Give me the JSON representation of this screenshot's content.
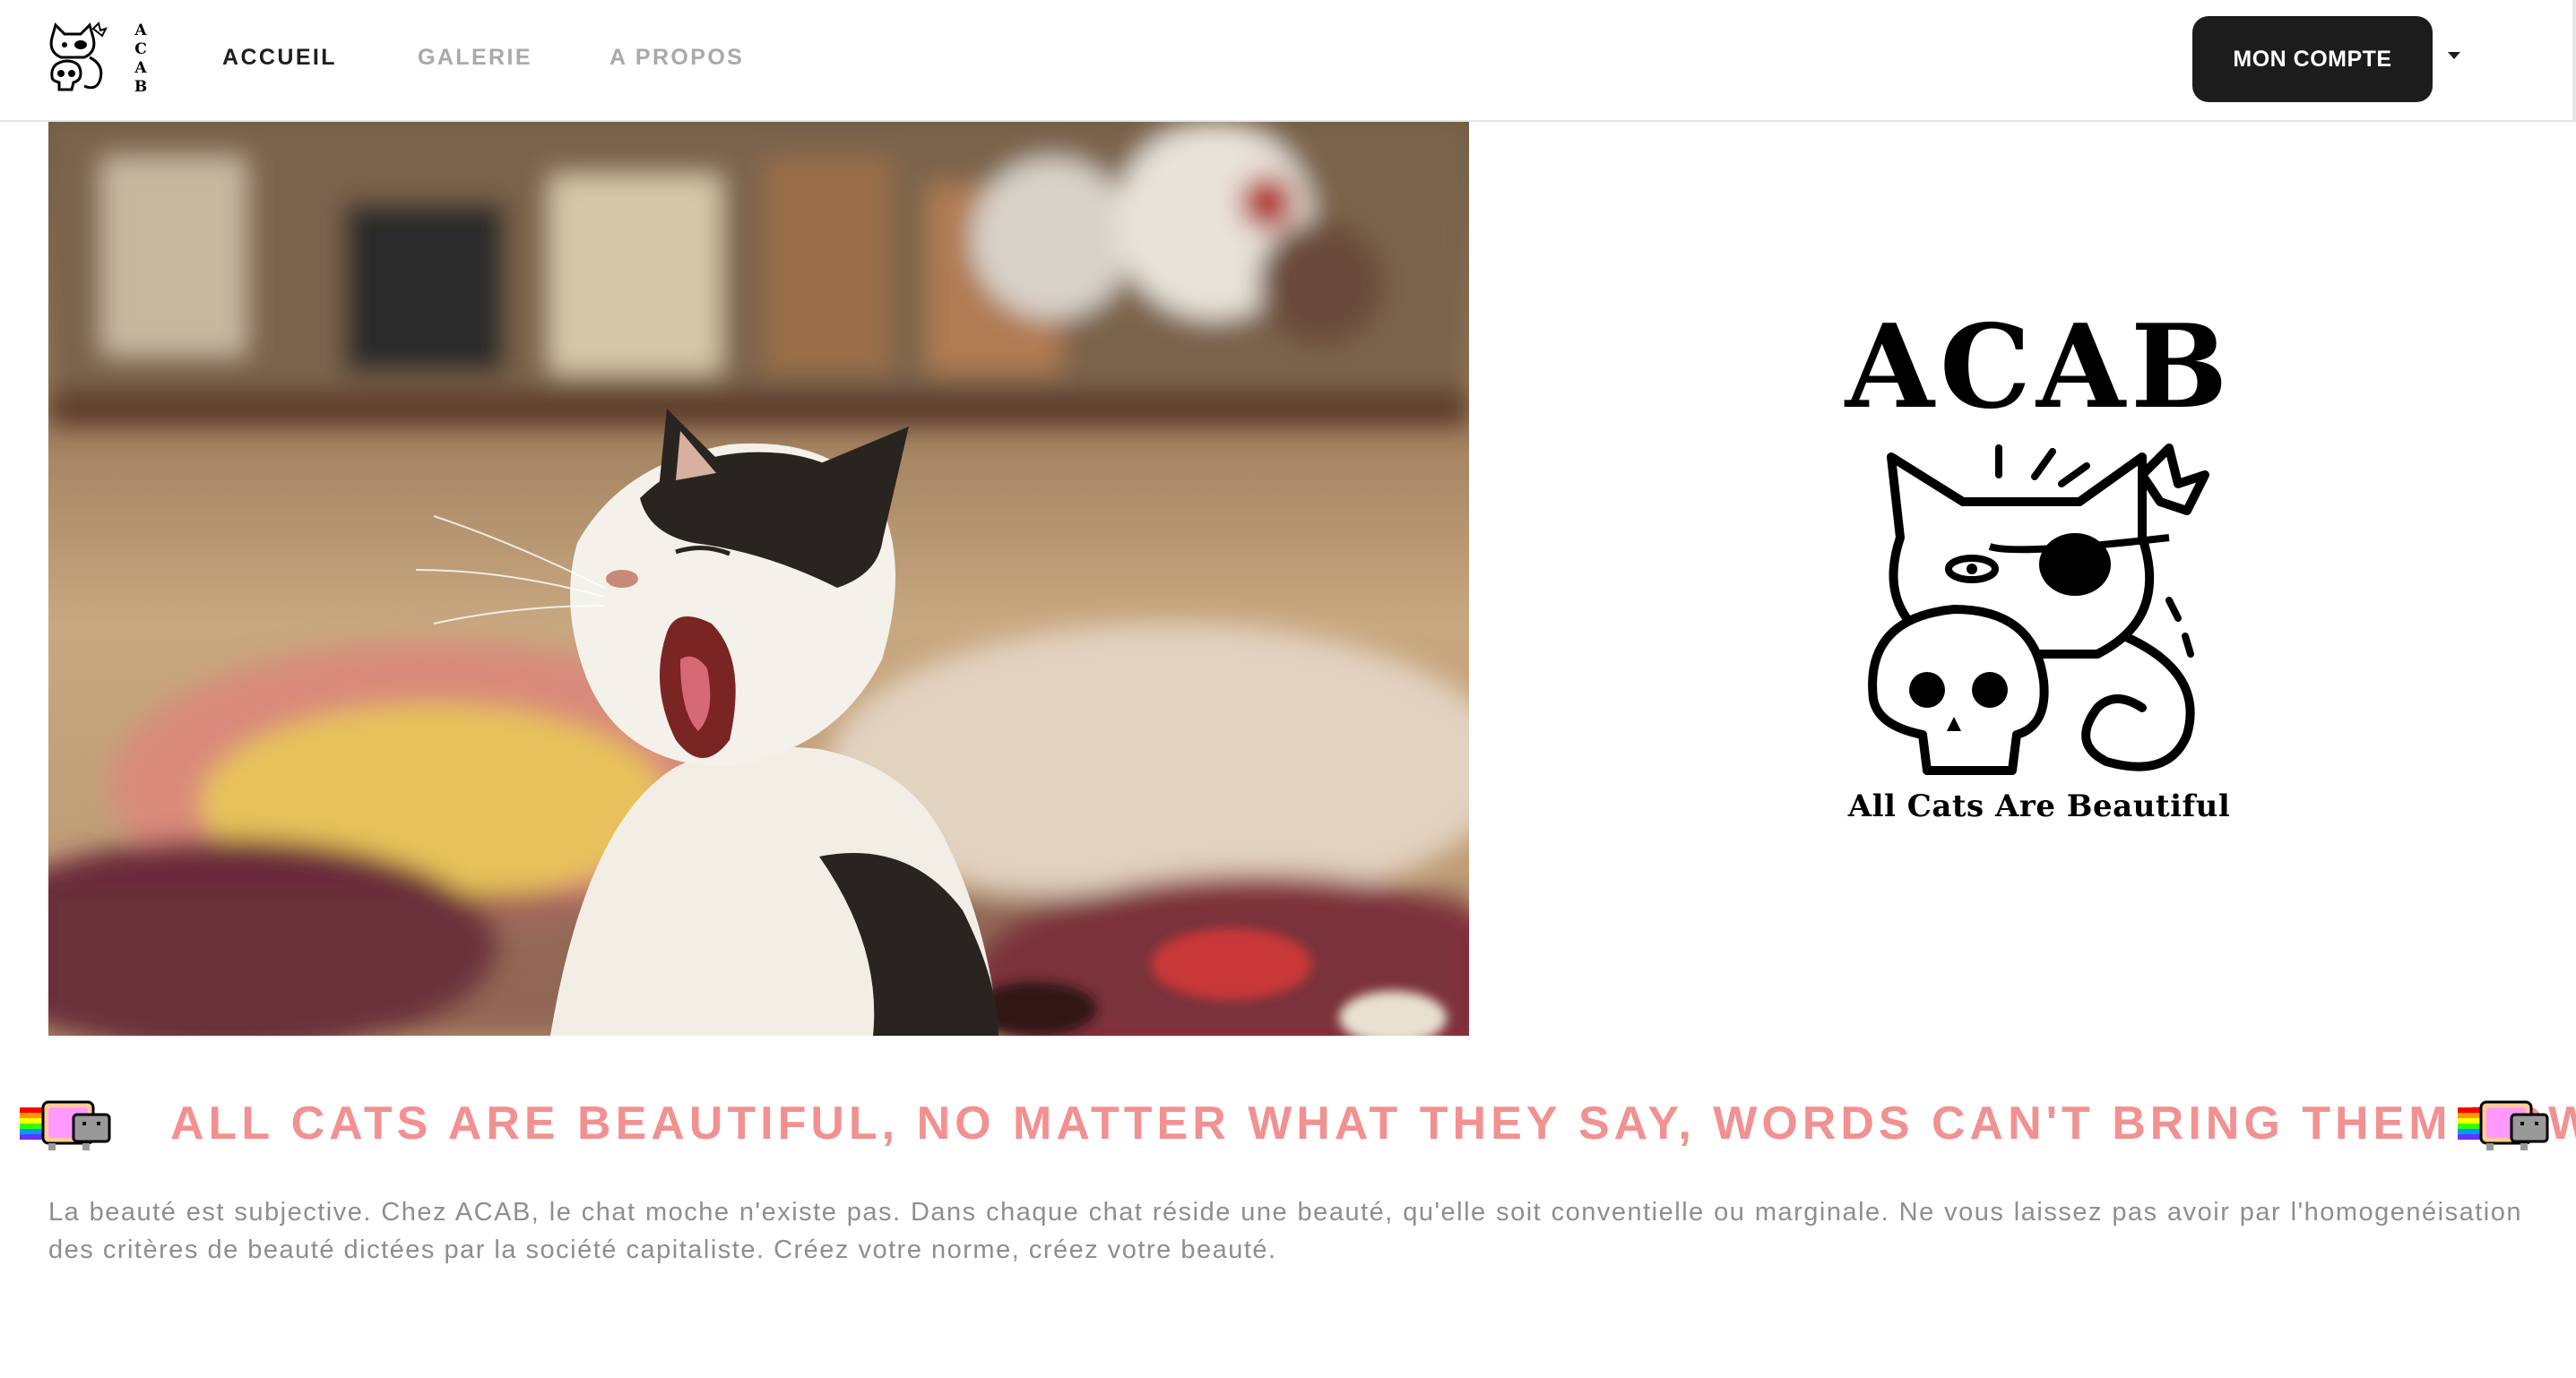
{
  "nav": {
    "links": [
      {
        "label": "ACCUEIL",
        "active": true
      },
      {
        "label": "GALERIE",
        "active": false
      },
      {
        "label": "A PROPOS",
        "active": false
      }
    ],
    "account_button": "MON COMPTE",
    "logo_letters": [
      "A",
      "C",
      "A",
      "B"
    ]
  },
  "hero": {
    "photo_subject": "yawning black-and-white cat",
    "logo_title": "ACAB",
    "logo_subtitle": "All Cats Are Beautiful"
  },
  "slogan": "ALL CATS ARE BEAUTIFUL, NO MATTER WHAT THEY SAY, WORDS CAN'T BRING THEM DOWN",
  "description": "La beauté est subjective. Chez ACAB, le chat moche n'existe pas. Dans chaque chat réside une beauté, qu'elle soit conventielle ou marginale. Ne vous laissez pas avoir par l'homogenéisation des critères de beauté dictées par la société capitaliste. Créez votre norme, créez votre beauté.",
  "colors": {
    "slogan": "#f29191",
    "text_muted": "#8e8e8e",
    "button_bg": "#1c1c1c"
  },
  "icons": [
    "acab-logo-icon",
    "nyan-cat-icon",
    "caret-down-icon"
  ]
}
